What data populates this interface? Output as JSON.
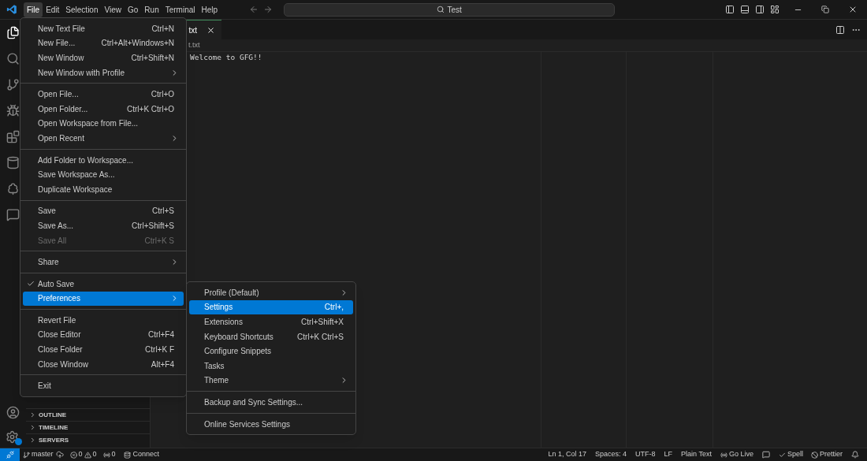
{
  "title_bar": {
    "menus": [
      {
        "label": "File",
        "selected": true
      },
      {
        "label": "Edit",
        "selected": false
      },
      {
        "label": "Selection",
        "selected": false
      },
      {
        "label": "View",
        "selected": false
      },
      {
        "label": "Go",
        "selected": false
      },
      {
        "label": "Run",
        "selected": false
      },
      {
        "label": "Terminal",
        "selected": false
      },
      {
        "label": "Help",
        "selected": false
      }
    ],
    "search": "Test"
  },
  "editor": {
    "tab": {
      "label": "txt"
    },
    "breadcrumb": "t.txt",
    "lines": [
      "Welcome to GFG!!"
    ]
  },
  "sidebar": {
    "sections": [
      {
        "label": "OUTLINE",
        "expanded": false
      },
      {
        "label": "TIMELINE",
        "expanded": false
      },
      {
        "label": "SERVERS",
        "expanded": false
      }
    ]
  },
  "file_menu": {
    "groups": [
      [
        {
          "label": "New Text File",
          "shortcut": "Ctrl+N",
          "submenu": false,
          "checked": false,
          "disabled": false,
          "selected": false
        },
        {
          "label": "New File...",
          "shortcut": "Ctrl+Alt+Windows+N",
          "submenu": false,
          "checked": false,
          "disabled": false,
          "selected": false
        },
        {
          "label": "New Window",
          "shortcut": "Ctrl+Shift+N",
          "submenu": false,
          "checked": false,
          "disabled": false,
          "selected": false
        },
        {
          "label": "New Window with Profile",
          "submenu": true,
          "checked": false,
          "disabled": false,
          "selected": false
        }
      ],
      [
        {
          "label": "Open File...",
          "shortcut": "Ctrl+O",
          "submenu": false,
          "checked": false,
          "disabled": false,
          "selected": false
        },
        {
          "label": "Open Folder...",
          "shortcut": "Ctrl+K Ctrl+O",
          "submenu": false,
          "checked": false,
          "disabled": false,
          "selected": false
        },
        {
          "label": "Open Workspace from File...",
          "submenu": false,
          "checked": false,
          "disabled": false,
          "selected": false
        },
        {
          "label": "Open Recent",
          "submenu": true,
          "checked": false,
          "disabled": false,
          "selected": false
        }
      ],
      [
        {
          "label": "Add Folder to Workspace...",
          "submenu": false,
          "checked": false,
          "disabled": false,
          "selected": false
        },
        {
          "label": "Save Workspace As...",
          "submenu": false,
          "checked": false,
          "disabled": false,
          "selected": false
        },
        {
          "label": "Duplicate Workspace",
          "submenu": false,
          "checked": false,
          "disabled": false,
          "selected": false
        }
      ],
      [
        {
          "label": "Save",
          "shortcut": "Ctrl+S",
          "submenu": false,
          "checked": false,
          "disabled": false,
          "selected": false
        },
        {
          "label": "Save As...",
          "shortcut": "Ctrl+Shift+S",
          "submenu": false,
          "checked": false,
          "disabled": false,
          "selected": false
        },
        {
          "label": "Save All",
          "shortcut": "Ctrl+K S",
          "submenu": false,
          "checked": false,
          "disabled": true,
          "selected": false
        }
      ],
      [
        {
          "label": "Share",
          "submenu": true,
          "checked": false,
          "disabled": false,
          "selected": false
        }
      ],
      [
        {
          "label": "Auto Save",
          "submenu": false,
          "checked": true,
          "disabled": false,
          "selected": false
        },
        {
          "label": "Preferences",
          "submenu": true,
          "checked": false,
          "disabled": false,
          "selected": true
        }
      ],
      [
        {
          "label": "Revert File",
          "submenu": false,
          "checked": false,
          "disabled": false,
          "selected": false
        },
        {
          "label": "Close Editor",
          "shortcut": "Ctrl+F4",
          "submenu": false,
          "checked": false,
          "disabled": false,
          "selected": false
        },
        {
          "label": "Close Folder",
          "shortcut": "Ctrl+K F",
          "submenu": false,
          "checked": false,
          "disabled": false,
          "selected": false
        },
        {
          "label": "Close Window",
          "shortcut": "Alt+F4",
          "submenu": false,
          "checked": false,
          "disabled": false,
          "selected": false
        }
      ],
      [
        {
          "label": "Exit",
          "submenu": false,
          "checked": false,
          "disabled": false,
          "selected": false
        }
      ]
    ]
  },
  "preferences_menu": {
    "groups": [
      [
        {
          "label": "Profile (Default)",
          "submenu": true,
          "checked": false,
          "disabled": false,
          "selected": false
        },
        {
          "label": "Settings",
          "shortcut": "Ctrl+,",
          "submenu": false,
          "checked": false,
          "disabled": false,
          "selected": true
        },
        {
          "label": "Extensions",
          "shortcut": "Ctrl+Shift+X",
          "submenu": false,
          "checked": false,
          "disabled": false,
          "selected": false
        },
        {
          "label": "Keyboard Shortcuts",
          "shortcut": "Ctrl+K Ctrl+S",
          "submenu": false,
          "checked": false,
          "disabled": false,
          "selected": false
        },
        {
          "label": "Configure Snippets",
          "submenu": false,
          "checked": false,
          "disabled": false,
          "selected": false
        },
        {
          "label": "Tasks",
          "submenu": false,
          "checked": false,
          "disabled": false,
          "selected": false
        },
        {
          "label": "Theme",
          "submenu": true,
          "checked": false,
          "disabled": false,
          "selected": false
        }
      ],
      [
        {
          "label": "Backup and Sync Settings...",
          "submenu": false,
          "checked": false,
          "disabled": false,
          "selected": false
        }
      ],
      [
        {
          "label": "Online Services Settings",
          "submenu": false,
          "checked": false,
          "disabled": false,
          "selected": false
        }
      ]
    ]
  },
  "status_bar": {
    "branch": "master",
    "errors": "0",
    "warnings": "0",
    "ports": "0",
    "connect": "Connect",
    "items": [
      "Ln 1, Col 17",
      "Spaces: 4",
      "UTF-8",
      "LF",
      "Plain Text"
    ],
    "go_live": "Go Live",
    "spell": "Spell",
    "prettier": "Prettier"
  }
}
